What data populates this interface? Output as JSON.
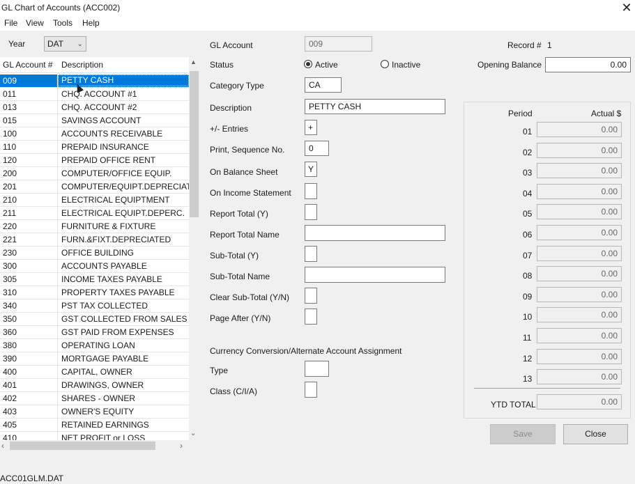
{
  "window": {
    "title": "GL Chart of Accounts (ACC002)",
    "close_glyph": "✕"
  },
  "menu": [
    "File",
    "View",
    "Tools",
    "Help"
  ],
  "year": {
    "label": "Year",
    "value": "DAT"
  },
  "accounts": {
    "headers": [
      "GL Account #",
      "Description"
    ],
    "rows": [
      {
        "code": "009",
        "desc": "PETTY CASH"
      },
      {
        "code": "011",
        "desc": "CHQ. ACCOUNT #1"
      },
      {
        "code": "013",
        "desc": "CHQ. ACCOUNT #2"
      },
      {
        "code": "015",
        "desc": "SAVINGS ACCOUNT"
      },
      {
        "code": "100",
        "desc": "ACCOUNTS RECEIVABLE"
      },
      {
        "code": "110",
        "desc": "PREPAID INSURANCE"
      },
      {
        "code": "120",
        "desc": "PREPAID OFFICE RENT"
      },
      {
        "code": "200",
        "desc": "COMPUTER/OFFICE EQUIP."
      },
      {
        "code": "201",
        "desc": "COMPUTER/EQUIPT.DEPRECIAT"
      },
      {
        "code": "210",
        "desc": "ELECTRICAL EQUIPTMENT"
      },
      {
        "code": "211",
        "desc": "ELECTRICAL EQUIPT.DEPERC."
      },
      {
        "code": "220",
        "desc": "FURNITURE & FIXTURE"
      },
      {
        "code": "221",
        "desc": "FURN.&FIXT.DEPRECIATED"
      },
      {
        "code": "230",
        "desc": "OFFICE BUILDING"
      },
      {
        "code": "300",
        "desc": "ACCOUNTS PAYABLE"
      },
      {
        "code": "305",
        "desc": "INCOME TAXES PAYABLE"
      },
      {
        "code": "310",
        "desc": "PROPERTY TAXES PAYABLE"
      },
      {
        "code": "340",
        "desc": "PST TAX COLLECTED"
      },
      {
        "code": "350",
        "desc": "GST COLLECTED FROM SALES"
      },
      {
        "code": "360",
        "desc": "GST PAID FROM EXPENSES"
      },
      {
        "code": "380",
        "desc": "OPERATING LOAN"
      },
      {
        "code": "390",
        "desc": "MORTGAGE PAYABLE"
      },
      {
        "code": "400",
        "desc": "CAPITAL, OWNER"
      },
      {
        "code": "401",
        "desc": "DRAWINGS, OWNER"
      },
      {
        "code": "402",
        "desc": "SHARES - OWNER"
      },
      {
        "code": "403",
        "desc": "OWNER'S EQUITY"
      },
      {
        "code": "405",
        "desc": "RETAINED EARNINGS"
      },
      {
        "code": "410",
        "desc": "NET PROFIT or LOSS"
      }
    ],
    "selected_index": 0
  },
  "form": {
    "gl_account": {
      "label": "GL Account",
      "value": "009"
    },
    "status": {
      "label": "Status",
      "active_label": "Active",
      "inactive_label": "Inactive",
      "selected": "Active"
    },
    "category_type": {
      "label": "Category Type",
      "value": "CA"
    },
    "description": {
      "label": "Description",
      "value": "PETTY CASH"
    },
    "entries": {
      "label": "+/- Entries",
      "value": "+"
    },
    "print_seq": {
      "label": "Print, Sequence No.",
      "value": "0"
    },
    "balance_sheet": {
      "label": "On Balance Sheet",
      "value": "Y"
    },
    "income_statement": {
      "label": "On Income Statement",
      "value": ""
    },
    "report_total": {
      "label": "Report Total (Y)",
      "value": ""
    },
    "report_total_name": {
      "label": "Report Total Name",
      "value": ""
    },
    "sub_total": {
      "label": "Sub-Total (Y)",
      "value": ""
    },
    "sub_total_name": {
      "label": "Sub-Total Name",
      "value": ""
    },
    "clear_sub_total": {
      "label": "Clear Sub-Total (Y/N)",
      "value": ""
    },
    "page_after": {
      "label": "Page After (Y/N)",
      "value": ""
    },
    "currency_heading": "Currency Conversion/Alternate Account Assignment",
    "type": {
      "label": "Type",
      "value": ""
    },
    "class": {
      "label": "Class (C/I/A)",
      "value": ""
    }
  },
  "record": {
    "label": "Record #",
    "value": "1"
  },
  "opening_balance": {
    "label": "Opening Balance",
    "value": "0.00"
  },
  "periods": {
    "header_period": "Period",
    "header_actual": "Actual $",
    "rows": [
      {
        "period": "01",
        "value": "0.00"
      },
      {
        "period": "02",
        "value": "0.00"
      },
      {
        "period": "03",
        "value": "0.00"
      },
      {
        "period": "04",
        "value": "0.00"
      },
      {
        "period": "05",
        "value": "0.00"
      },
      {
        "period": "06",
        "value": "0.00"
      },
      {
        "period": "07",
        "value": "0.00"
      },
      {
        "period": "08",
        "value": "0.00"
      },
      {
        "period": "09",
        "value": "0.00"
      },
      {
        "period": "10",
        "value": "0.00"
      },
      {
        "period": "11",
        "value": "0.00"
      },
      {
        "period": "12",
        "value": "0.00"
      },
      {
        "period": "13",
        "value": "0.00"
      }
    ],
    "ytd_label": "YTD TOTAL",
    "ytd_value": "0.00"
  },
  "buttons": {
    "save": "Save",
    "close": "Close"
  },
  "status_bar": "ACC01GLM.DAT",
  "colors": {
    "selection": "#0078d7"
  }
}
